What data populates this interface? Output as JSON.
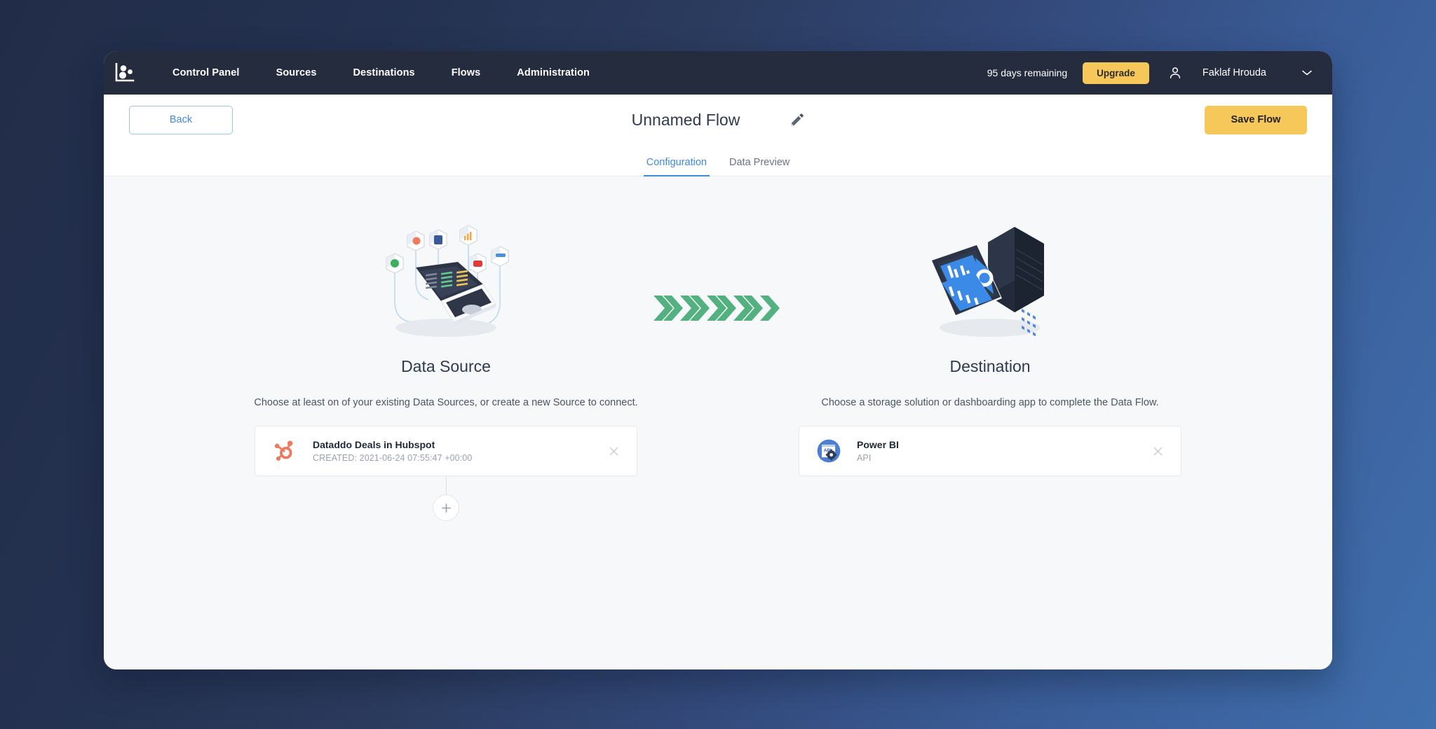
{
  "navbar": {
    "logo_icon": "dataddo-logo-icon",
    "links": [
      {
        "label": "Control Panel"
      },
      {
        "label": "Sources"
      },
      {
        "label": "Destinations"
      },
      {
        "label": "Flows"
      },
      {
        "label": "Administration"
      }
    ],
    "days_remaining": "95 days remaining",
    "upgrade_label": "Upgrade",
    "user_icon": "user-avatar-icon",
    "user_name": "Faklaf Hrouda",
    "chevron_icon": "chevron-down-icon",
    "background_color": "#252c3d"
  },
  "header": {
    "back_label": "Back",
    "flow_title": "Unnamed Flow",
    "edit_icon": "pencil-icon",
    "save_label": "Save Flow",
    "save_color": "#f6c85a",
    "back_accent": "#3e8ae0"
  },
  "tabs": {
    "items": [
      {
        "label": "Configuration",
        "active": true
      },
      {
        "label": "Data Preview",
        "active": false
      }
    ],
    "active_color": "#3e8ae0"
  },
  "source": {
    "illustration": "laptop-with-connected-apps-illustration",
    "title": "Data Source",
    "description": "Choose at least on of your existing Data Sources, or create a new Source to connect.",
    "card": {
      "logo_icon": "hubspot-logo-icon",
      "logo_color": "#ed7a5e",
      "name": "Dataddo Deals in Hubspot",
      "subtitle": "CREATED: 2021-06-24 07:55:47 +00:00",
      "close_icon": "close-icon"
    },
    "add_icon": "plus-icon"
  },
  "arrows": {
    "icon": "chevron-right-arrows",
    "count": 5,
    "color": "#53b07f"
  },
  "destination": {
    "illustration": "tablet-dashboard-and-server-illustration",
    "title": "Destination",
    "description": "Choose a storage solution or dashboarding app to complete the Data Flow.",
    "card": {
      "logo_icon": "power-bi-api-icon",
      "logo_color": "#4a7fd4",
      "logo_text": "API",
      "name": "Power BI",
      "subtitle": "API",
      "close_icon": "close-icon"
    }
  },
  "page": {
    "canvas_color": "#f7f8fa",
    "backdrop_from": "#212d48",
    "backdrop_to": "#4070ae"
  }
}
